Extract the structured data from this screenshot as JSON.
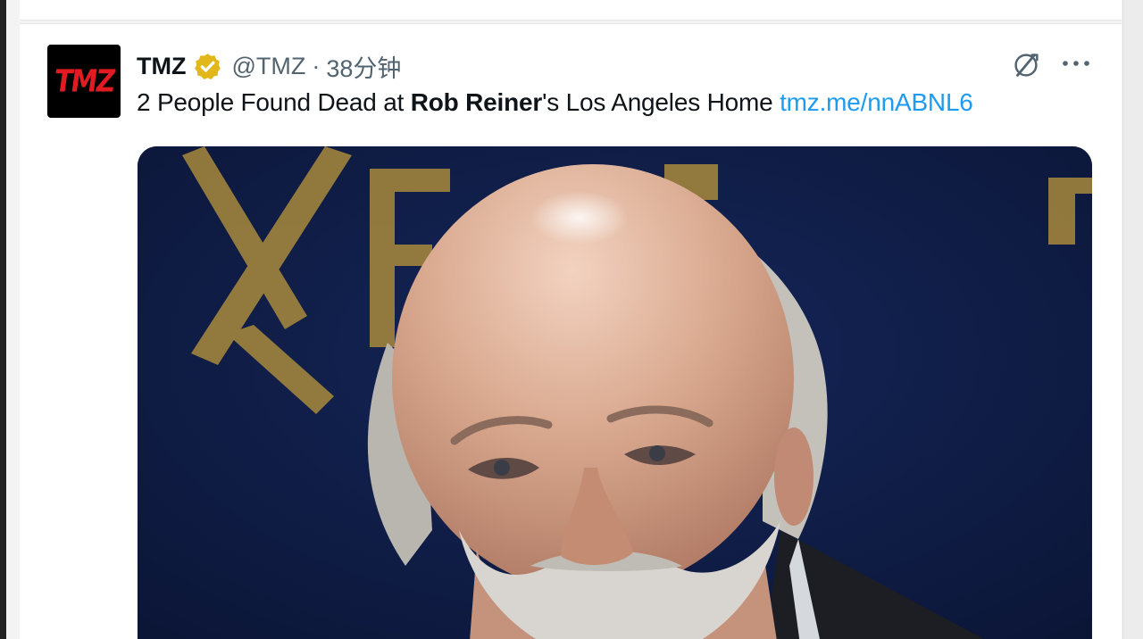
{
  "tweet": {
    "author_name": "TMZ",
    "avatar_logo_text": "TMZ",
    "verified_badge_color": "#e2b719",
    "handle": "@TMZ",
    "separator": "·",
    "time_ago": "38分钟",
    "text_before": "2 People Found Dead at ",
    "text_bold": "Rob Reiner",
    "text_after": "'s Los Angeles Home ",
    "link_text": "tmz.me/nnABNL6",
    "link_color": "#1d9bf0"
  },
  "icons": {
    "grok": "grok-icon",
    "more": "more-options-icon",
    "verified": "verified-badge-icon"
  },
  "media": {
    "background_color": "#0c1838",
    "logo_color": "#a98a3c"
  }
}
